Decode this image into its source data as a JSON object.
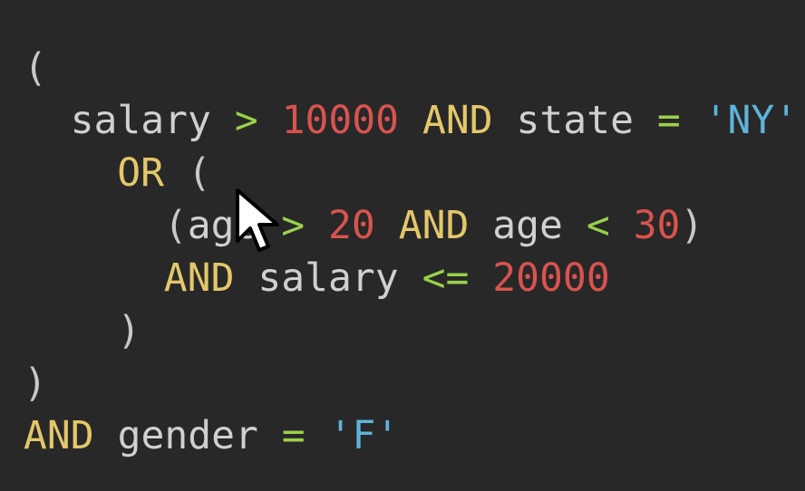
{
  "colors": {
    "background": "#282828",
    "plain": "#d0d0d0",
    "keyword": "#e3c76a",
    "operator": "#9bd14b",
    "number": "#d9534f",
    "string": "#5fb3d9",
    "punct": "#c8c8c8"
  },
  "editor": {
    "lines": [
      {
        "indent": 0,
        "tokens": [
          {
            "t": "(",
            "k": "punct"
          }
        ]
      },
      {
        "indent": 2,
        "tokens": [
          {
            "t": "salary",
            "k": "plain"
          },
          {
            "t": " ",
            "k": "plain"
          },
          {
            "t": ">",
            "k": "operator"
          },
          {
            "t": " ",
            "k": "plain"
          },
          {
            "t": "10000",
            "k": "number"
          },
          {
            "t": " ",
            "k": "plain"
          },
          {
            "t": "AND",
            "k": "keyword"
          },
          {
            "t": " ",
            "k": "plain"
          },
          {
            "t": "state",
            "k": "plain"
          },
          {
            "t": " ",
            "k": "plain"
          },
          {
            "t": "=",
            "k": "operator"
          },
          {
            "t": " ",
            "k": "plain"
          },
          {
            "t": "'NY'",
            "k": "string"
          }
        ]
      },
      {
        "indent": 4,
        "tokens": [
          {
            "t": "OR",
            "k": "keyword"
          },
          {
            "t": " ",
            "k": "plain"
          },
          {
            "t": "(",
            "k": "punct"
          }
        ]
      },
      {
        "indent": 6,
        "tokens": [
          {
            "t": "(",
            "k": "punct"
          },
          {
            "t": "age",
            "k": "plain"
          },
          {
            "t": " ",
            "k": "plain"
          },
          {
            "t": ">",
            "k": "operator"
          },
          {
            "t": " ",
            "k": "plain"
          },
          {
            "t": "20",
            "k": "number"
          },
          {
            "t": " ",
            "k": "plain"
          },
          {
            "t": "AND",
            "k": "keyword"
          },
          {
            "t": " ",
            "k": "plain"
          },
          {
            "t": "age",
            "k": "plain"
          },
          {
            "t": " ",
            "k": "plain"
          },
          {
            "t": "<",
            "k": "operator"
          },
          {
            "t": " ",
            "k": "plain"
          },
          {
            "t": "30",
            "k": "number"
          },
          {
            "t": ")",
            "k": "punct"
          }
        ]
      },
      {
        "indent": 6,
        "tokens": [
          {
            "t": "AND",
            "k": "keyword"
          },
          {
            "t": " ",
            "k": "plain"
          },
          {
            "t": "salary",
            "k": "plain"
          },
          {
            "t": " ",
            "k": "plain"
          },
          {
            "t": "<=",
            "k": "operator"
          },
          {
            "t": " ",
            "k": "plain"
          },
          {
            "t": "20000",
            "k": "number"
          }
        ]
      },
      {
        "indent": 4,
        "tokens": [
          {
            "t": ")",
            "k": "punct"
          }
        ]
      },
      {
        "indent": 0,
        "tokens": [
          {
            "t": ")",
            "k": "punct"
          }
        ]
      },
      {
        "indent": 0,
        "tokens": [
          {
            "t": "AND",
            "k": "keyword"
          },
          {
            "t": " ",
            "k": "plain"
          },
          {
            "t": "gender",
            "k": "plain"
          },
          {
            "t": " ",
            "k": "plain"
          },
          {
            "t": "=",
            "k": "operator"
          },
          {
            "t": " ",
            "k": "plain"
          },
          {
            "t": "'F'",
            "k": "string"
          }
        ]
      }
    ]
  },
  "cursor_icon": "mouse-pointer-icon"
}
